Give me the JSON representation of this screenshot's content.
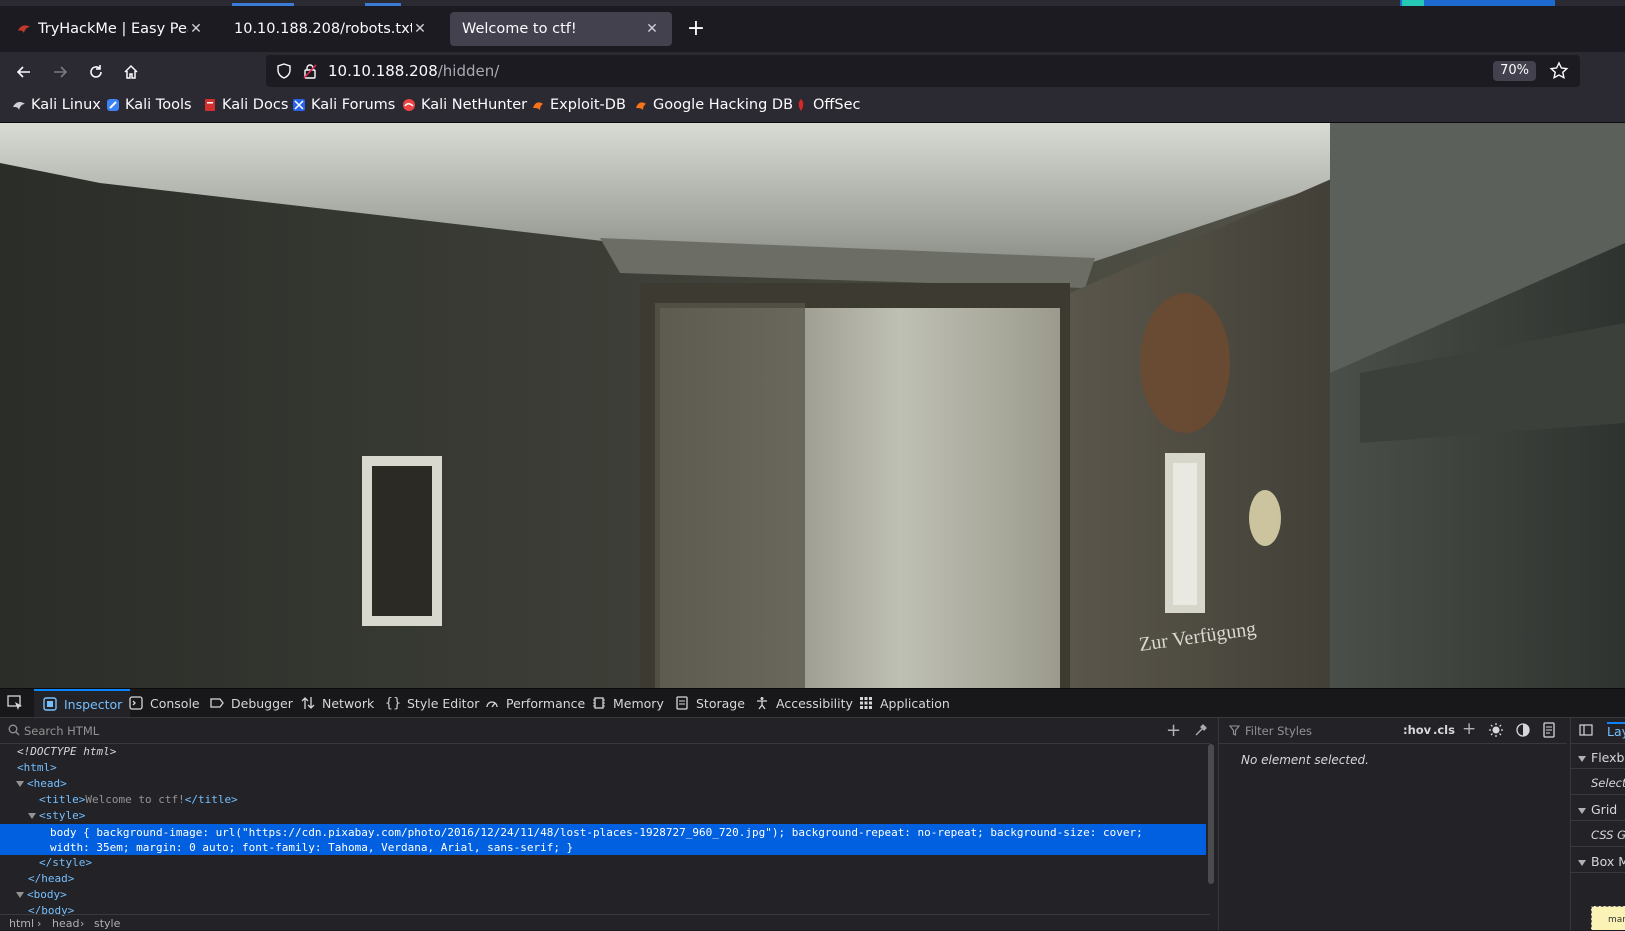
{
  "browser": {
    "tabs": [
      {
        "label": "TryHackMe | Easy Peasy",
        "active": false
      },
      {
        "label": "10.10.188.208/robots.txt",
        "active": false
      },
      {
        "label": "Welcome to ctf!",
        "active": true
      }
    ],
    "new_tab_label": "+",
    "url": {
      "host": "10.10.188.208",
      "path": "/hidden/"
    },
    "zoom": "70%",
    "bookmarks": [
      {
        "label": "Kali Linux",
        "icon": "kali-dragon-icon"
      },
      {
        "label": "Kali Tools",
        "icon": "kali-tools-icon"
      },
      {
        "label": "Kali Docs",
        "icon": "kali-docs-icon"
      },
      {
        "label": "Kali Forums",
        "icon": "kali-forums-icon"
      },
      {
        "label": "Kali NetHunter",
        "icon": "kali-nethunter-icon"
      },
      {
        "label": "Exploit-DB",
        "icon": "exploit-db-icon"
      },
      {
        "label": "Google Hacking DB",
        "icon": "ghdb-icon"
      },
      {
        "label": "OffSec",
        "icon": "offsec-icon"
      }
    ]
  },
  "page": {
    "background_sign_text": "Zur Verfügung"
  },
  "devtools": {
    "tabs": [
      {
        "label": "Inspector",
        "icon": "inspector-icon",
        "selected": true
      },
      {
        "label": "Console",
        "icon": "console-icon"
      },
      {
        "label": "Debugger",
        "icon": "debugger-icon"
      },
      {
        "label": "Network",
        "icon": "network-icon"
      },
      {
        "label": "Style Editor",
        "icon": "style-editor-icon"
      },
      {
        "label": "Performance",
        "icon": "performance-icon"
      },
      {
        "label": "Memory",
        "icon": "memory-icon"
      },
      {
        "label": "Storage",
        "icon": "storage-icon"
      },
      {
        "label": "Accessibility",
        "icon": "accessibility-icon"
      },
      {
        "label": "Application",
        "icon": "application-icon"
      }
    ],
    "search_placeholder": "Search HTML",
    "markup": {
      "doctype": "<!DOCTYPE html>",
      "html_open": "<html>",
      "head_open": "<head>",
      "title_open": "<title>",
      "title_text": "Welcome to ctf!",
      "title_close": "</title>",
      "style_open": "<style>",
      "style_content": "body { background-image: url(\"https://cdn.pixabay.com/photo/2016/12/24/11/48/lost-places-1928727_960_720.jpg\"); background-repeat: no-repeat; background-size: cover; width: 35em; margin: 0 auto; font-family: Tahoma, Verdana, Arial, sans-serif; }",
      "style_close": "</style>",
      "head_close": "</head>",
      "body_open": "<body>",
      "body_close": "</body>"
    },
    "breadcrumbs": [
      "html",
      "head",
      "style"
    ],
    "rules": {
      "filter_placeholder": "Filter Styles",
      "hov": ":hov",
      "cls": ".cls",
      "empty_message": "No element selected."
    },
    "layout": {
      "tab_label": "Layout",
      "sections": [
        {
          "title": "Flexbox",
          "hint": "Select a Flex container or item to continue."
        },
        {
          "title": "Grid",
          "hint": "CSS Grid is not in use on this page"
        },
        {
          "title": "Box Model",
          "hint": ""
        }
      ],
      "box_label": "margin"
    }
  }
}
